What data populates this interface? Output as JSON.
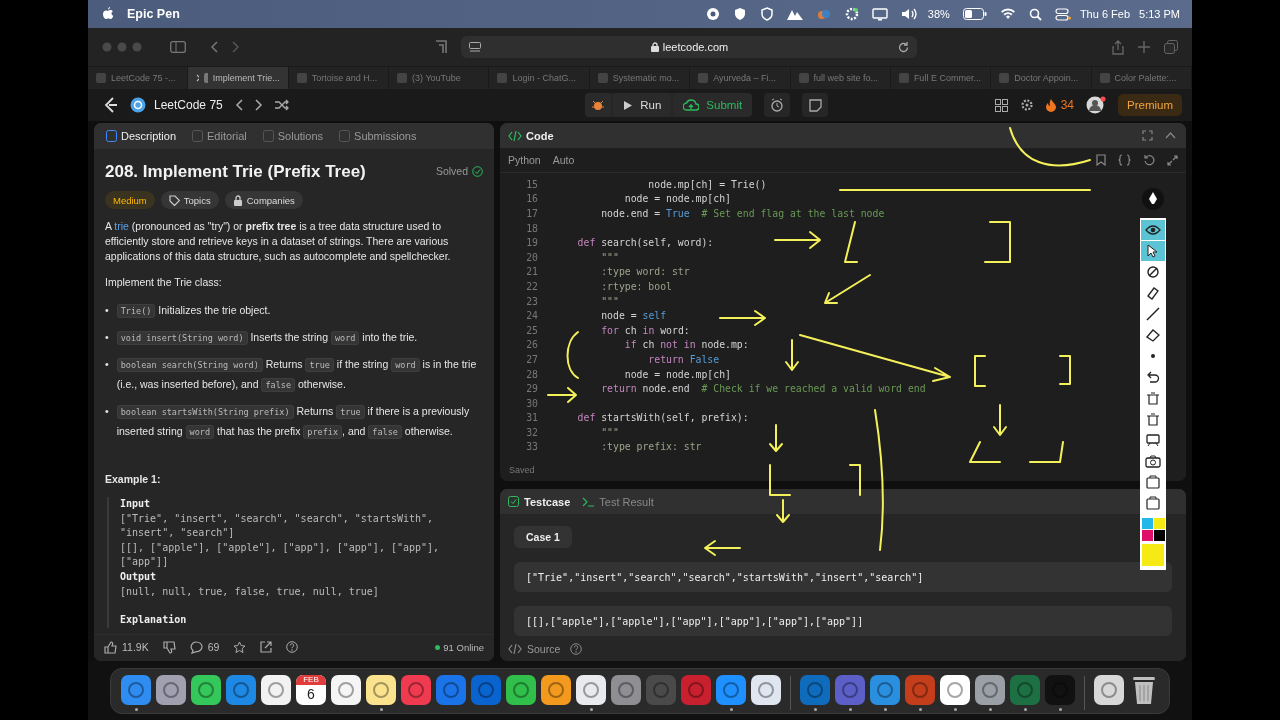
{
  "menu_bar": {
    "app_name": "Epic Pen",
    "battery": "38%",
    "date": "Thu 6 Feb",
    "time": "5:13 PM"
  },
  "browser": {
    "url": "leetcode.com",
    "tabs": [
      {
        "label": "LeetCode 75 -...",
        "selected": false
      },
      {
        "label": "Implement Trie...",
        "selected": true
      },
      {
        "label": "Tortoise and H...",
        "selected": false
      },
      {
        "label": "(3) YouTube",
        "selected": false
      },
      {
        "label": "Login - ChatG...",
        "selected": false
      },
      {
        "label": "Systematic mo...",
        "selected": false
      },
      {
        "label": "Ayurveda – Fi...",
        "selected": false
      },
      {
        "label": "full web site fo...",
        "selected": false
      },
      {
        "label": "Full E Commer...",
        "selected": false
      },
      {
        "label": "Doctor Appoin...",
        "selected": false
      },
      {
        "label": "Color Palette:...",
        "selected": false
      }
    ]
  },
  "header": {
    "title": "LeetCode 75",
    "run": "Run",
    "submit": "Submit",
    "streak": "34",
    "premium": "Premium"
  },
  "problem": {
    "tabs": [
      {
        "label": "Description",
        "selected": true
      },
      {
        "label": "Editorial",
        "selected": false
      },
      {
        "label": "Solutions",
        "selected": false
      },
      {
        "label": "Submissions",
        "selected": false
      }
    ],
    "title": "208. Implement Trie (Prefix Tree)",
    "status": "Solved",
    "difficulty": "Medium",
    "tags": [
      "Topics",
      "Companies"
    ],
    "intro": [
      {
        "kind": "text",
        "t": "A "
      },
      {
        "kind": "link",
        "t": "trie"
      },
      {
        "kind": "text",
        "t": " (pronounced as \"try\") or "
      },
      {
        "kind": "bold",
        "t": "prefix tree"
      },
      {
        "kind": "text",
        "t": " is a tree data structure used to efficiently store and retrieve keys in a dataset of strings. There are various applications of this data structure, such as autocomplete and spellchecker."
      }
    ],
    "class_line": "Implement the Trie class:",
    "bullets": [
      {
        "marker": "•",
        "parts": [
          {
            "kind": "code",
            "t": "Trie()"
          },
          {
            "kind": "text",
            "t": " Initializes the trie object."
          }
        ]
      },
      {
        "marker": "•",
        "parts": [
          {
            "kind": "code",
            "t": "void insert(String word)"
          },
          {
            "kind": "text",
            "t": " Inserts the string "
          },
          {
            "kind": "code",
            "t": "word"
          },
          {
            "kind": "text",
            "t": " into the trie."
          }
        ]
      },
      {
        "marker": "•",
        "parts": [
          {
            "kind": "code",
            "t": "boolean search(String word)"
          },
          {
            "kind": "text",
            "t": " Returns "
          },
          {
            "kind": "code",
            "t": "true"
          },
          {
            "kind": "text",
            "t": " if the string "
          },
          {
            "kind": "code",
            "t": "word"
          },
          {
            "kind": "text",
            "t": " is in the trie (i.e., was inserted before), and "
          },
          {
            "kind": "code",
            "t": "false"
          },
          {
            "kind": "text",
            "t": " otherwise."
          }
        ]
      },
      {
        "marker": "•",
        "parts": [
          {
            "kind": "code",
            "t": "boolean startsWith(String prefix)"
          },
          {
            "kind": "text",
            "t": " Returns "
          },
          {
            "kind": "code",
            "t": "true"
          },
          {
            "kind": "text",
            "t": " if there is a previously inserted string "
          },
          {
            "kind": "code",
            "t": "word"
          },
          {
            "kind": "text",
            "t": " that has the prefix "
          },
          {
            "kind": "code",
            "t": "prefix"
          },
          {
            "kind": "text",
            "t": ", and "
          },
          {
            "kind": "code",
            "t": "false"
          },
          {
            "kind": "text",
            "t": " otherwise."
          }
        ]
      }
    ],
    "example": {
      "heading": "Example 1:",
      "input_label": "Input",
      "input_lines": [
        "[\"Trie\", \"insert\", \"search\", \"search\", \"startsWith\",",
        "\"insert\", \"search\"]",
        "[[], [\"apple\"], [\"apple\"], [\"app\"], [\"app\"], [\"app\"],",
        "[\"app\"]]"
      ],
      "output_label": "Output",
      "output_lines": [
        "[null, null, true, false, true, null, true]"
      ],
      "explanation_label": "Explanation"
    },
    "likes": "11.9K",
    "comments": "69",
    "online": "91 Online"
  },
  "editor": {
    "title": "Code",
    "language": "Python",
    "mode": "Auto",
    "status": "Saved",
    "lines": [
      {
        "number": "15",
        "tokens": [
          {
            "kind": "plain",
            "t": "                node.mp[ch] = Trie()"
          }
        ]
      },
      {
        "number": "16",
        "tokens": [
          {
            "kind": "plain",
            "t": "            node = node.mp[ch]"
          }
        ]
      },
      {
        "number": "17",
        "tokens": [
          {
            "kind": "plain",
            "t": "        node.end = "
          },
          {
            "kind": "const",
            "t": "True"
          },
          {
            "kind": "comment",
            "t": "  # Set end flag at the last node"
          }
        ]
      },
      {
        "number": "18"
      },
      {
        "number": "19",
        "tokens": [
          {
            "kind": "kw",
            "t": "    def "
          },
          {
            "kind": "plain",
            "t": "search(self, word):"
          }
        ]
      },
      {
        "number": "20",
        "tokens": [
          {
            "kind": "str",
            "t": "        \"\"\""
          }
        ]
      },
      {
        "number": "21",
        "tokens": [
          {
            "kind": "str",
            "t": "        :type word: str"
          }
        ]
      },
      {
        "number": "22",
        "tokens": [
          {
            "kind": "str",
            "t": "        :rtype: bool"
          }
        ]
      },
      {
        "number": "23",
        "tokens": [
          {
            "kind": "str",
            "t": "        \"\"\""
          }
        ]
      },
      {
        "number": "24",
        "tokens": [
          {
            "kind": "plain",
            "t": "        node = "
          },
          {
            "kind": "const",
            "t": "self"
          }
        ]
      },
      {
        "number": "25",
        "tokens": [
          {
            "kind": "kw",
            "t": "        for "
          },
          {
            "kind": "plain",
            "t": "ch "
          },
          {
            "kind": "kw",
            "t": "in "
          },
          {
            "kind": "plain",
            "t": "word:"
          }
        ]
      },
      {
        "number": "26",
        "tokens": [
          {
            "kind": "kw",
            "t": "            if "
          },
          {
            "kind": "plain",
            "t": "ch "
          },
          {
            "kind": "kw",
            "t": "not in "
          },
          {
            "kind": "plain",
            "t": "node.mp:"
          }
        ]
      },
      {
        "number": "27",
        "tokens": [
          {
            "kind": "kw",
            "t": "                return "
          },
          {
            "kind": "const",
            "t": "False"
          }
        ]
      },
      {
        "number": "28",
        "tokens": [
          {
            "kind": "plain",
            "t": "            node = node.mp[ch]"
          }
        ]
      },
      {
        "number": "29",
        "tokens": [
          {
            "kind": "kw",
            "t": "        return "
          },
          {
            "kind": "plain",
            "t": "node.end"
          },
          {
            "kind": "comment",
            "t": "  # Check if we reached a valid word end"
          }
        ]
      },
      {
        "number": "30"
      },
      {
        "number": "31",
        "tokens": [
          {
            "kind": "kw",
            "t": "    def "
          },
          {
            "kind": "plain",
            "t": "startsWith(self, prefix):"
          }
        ]
      },
      {
        "number": "32",
        "tokens": [
          {
            "kind": "str",
            "t": "        \"\"\""
          }
        ]
      },
      {
        "number": "33",
        "tokens": [
          {
            "kind": "str",
            "t": "        :type prefix: str"
          }
        ]
      }
    ]
  },
  "testcase": {
    "tabs": [
      {
        "label": "Testcase",
        "selected": true
      },
      {
        "label": "Test Result",
        "selected": false
      }
    ],
    "case": "Case 1",
    "values": [
      "[\"Trie\",\"insert\",\"search\",\"search\",\"startsWith\",\"insert\",\"search\"]",
      "[[],[\"apple\"],[\"apple\"],[\"app\"],[\"app\"],[\"app\"],[\"app\"]]"
    ],
    "source": "Source"
  },
  "pen_tools": [
    {
      "kind": "eye",
      "selected": true
    },
    {
      "kind": "cursor",
      "selected": true
    },
    {
      "kind": "ban",
      "selected": false
    },
    {
      "kind": "marker",
      "selected": false
    },
    {
      "kind": "line",
      "selected": false
    },
    {
      "kind": "eraser",
      "selected": false
    },
    {
      "kind": "dot",
      "selected": false
    },
    {
      "kind": "undo",
      "selected": false
    },
    {
      "kind": "bin",
      "selected": false
    },
    {
      "kind": "bin",
      "selected": false
    },
    {
      "kind": "board",
      "selected": false
    },
    {
      "kind": "camera",
      "selected": false
    },
    {
      "kind": "clip",
      "selected": false
    },
    {
      "kind": "clip",
      "selected": false
    }
  ],
  "pen_colors": [
    {
      "color": "#22b8e8"
    },
    {
      "color": "#f5ea14"
    },
    {
      "color": "#e0106a"
    },
    {
      "color": "#000000"
    }
  ],
  "dock": [
    {
      "kind": "app",
      "color": "#2f8cf0",
      "running": true
    },
    {
      "kind": "app",
      "color": "#a0a0b0",
      "running": false
    },
    {
      "kind": "app",
      "color": "#34c759",
      "running": false
    },
    {
      "kind": "app",
      "color": "#1e88e5",
      "running": false
    },
    {
      "kind": "app",
      "color": "#f2f2f2",
      "running": false
    },
    {
      "kind": "calendar",
      "color": "#ffffff",
      "running": false,
      "month": "FEB",
      "day": "6"
    },
    {
      "kind": "app",
      "color": "#f5f5f5",
      "running": false
    },
    {
      "kind": "app",
      "color": "#fbe38e",
      "running": true
    },
    {
      "kind": "app",
      "color": "#f03a50",
      "running": false
    },
    {
      "kind": "app",
      "color": "#1a73e8",
      "running": false
    },
    {
      "kind": "app",
      "color": "#0a64d0",
      "running": false
    },
    {
      "kind": "app",
      "color": "#2fbf4a",
      "running": false
    },
    {
      "kind": "app",
      "color": "#f39a1e",
      "running": false
    },
    {
      "kind": "app",
      "color": "#e8eaed",
      "running": true
    },
    {
      "kind": "app",
      "color": "#8e8e93",
      "running": false
    },
    {
      "kind": "app",
      "color": "#4a4a4a",
      "running": false
    },
    {
      "kind": "app",
      "color": "#c8202e",
      "running": false
    },
    {
      "kind": "app",
      "color": "#1e90ff",
      "running": true
    },
    {
      "kind": "app",
      "color": "#dfe6f0",
      "running": false
    },
    {
      "kind": "separator"
    },
    {
      "kind": "app",
      "color": "#0f6cbd",
      "running": true
    },
    {
      "kind": "app",
      "color": "#5b5fc7",
      "running": true
    },
    {
      "kind": "app",
      "color": "#2b8fe0",
      "running": true
    },
    {
      "kind": "app",
      "color": "#c43e1c",
      "running": true
    },
    {
      "kind": "app",
      "color": "#ffffff",
      "running": true
    },
    {
      "kind": "app",
      "color": "#9aa0a6",
      "running": true
    },
    {
      "kind": "app",
      "color": "#1d7044",
      "running": true
    },
    {
      "kind": "app",
      "color": "#111111",
      "running": true
    },
    {
      "kind": "separator"
    },
    {
      "kind": "app",
      "color": "#d8d8d8",
      "running": false
    },
    {
      "kind": "trash",
      "color": "#c0c0c0",
      "running": false
    }
  ]
}
